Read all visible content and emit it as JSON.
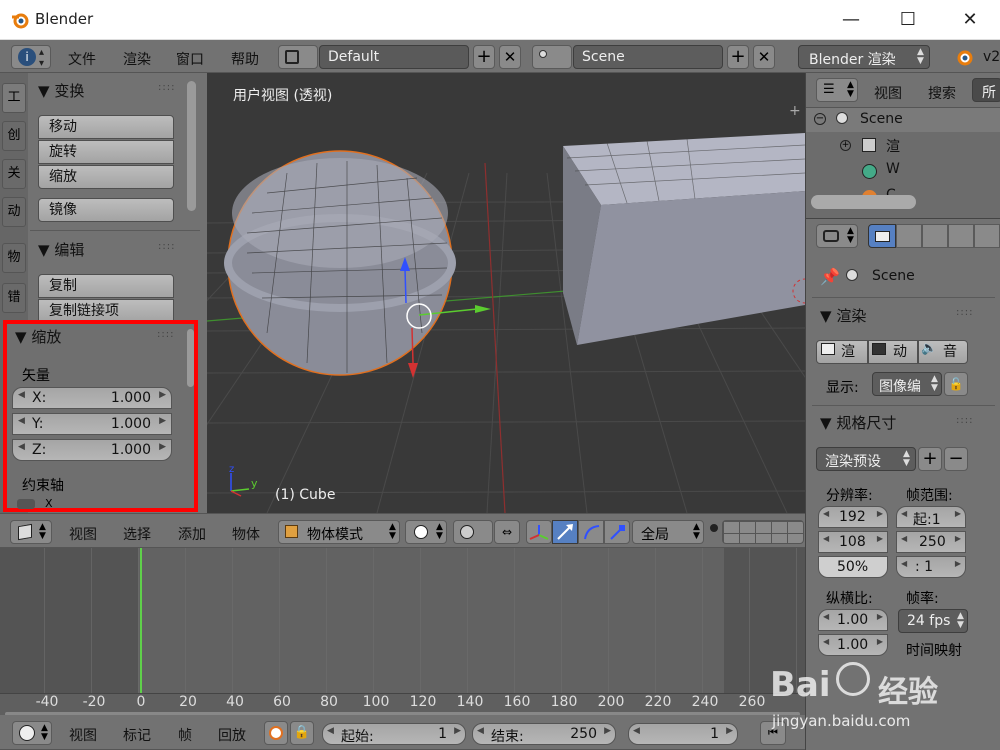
{
  "window": {
    "title": "Blender",
    "minimize": "—",
    "maximize": "☐",
    "close": "✕"
  },
  "topbar": {
    "menu": [
      "文件",
      "渲染",
      "窗口",
      "帮助"
    ],
    "layout": "Default",
    "scene": "Scene",
    "engine": "Blender 渲染",
    "version": "v2"
  },
  "toolshelf": {
    "tabs": [
      "工",
      "创",
      "关",
      "动",
      "物",
      "错"
    ],
    "transform": {
      "title": "变换",
      "buttons": [
        "移动",
        "旋转",
        "缩放"
      ],
      "mirror": "镜像"
    },
    "edit": {
      "title": "编辑",
      "buttons": [
        "复制",
        "复制链接项"
      ]
    }
  },
  "operator": {
    "title": "缩放",
    "vector_label": "矢量",
    "x_label": "X:",
    "x": "1.000",
    "y_label": "Y:",
    "y": "1.000",
    "z_label": "Z:",
    "z": "1.000",
    "constraint_label": "约束轴",
    "cb_x": "X"
  },
  "viewport": {
    "label": "用户视图 (透视)",
    "object": "(1) Cube"
  },
  "view3d_header": {
    "menu": [
      "视图",
      "选择",
      "添加",
      "物体"
    ],
    "mode": "物体模式",
    "orientation": "全局"
  },
  "outliner": {
    "menu": [
      "视图",
      "搜索",
      "所"
    ],
    "items": [
      "Scene",
      "渲",
      "W",
      "C"
    ]
  },
  "properties": {
    "scene_name": "Scene",
    "render_title": "渲染",
    "render_buttons": [
      "渲",
      "动",
      "音"
    ],
    "display_label": "显示:",
    "display_value": "图像编",
    "dimensions_title": "规格尺寸",
    "preset": "渲染预设",
    "res_label": "分辨率:",
    "res_x": "192",
    "res_y": "108",
    "res_pct": "50%",
    "frame_label": "帧范围:",
    "frame_start": "起:1",
    "frame_end": "250",
    "frame_step": ":  1",
    "aspect_label": "纵横比:",
    "aspect_x": "1.00",
    "aspect_y": "1.00",
    "fps_label": "帧率:",
    "fps": "24 fps",
    "remap_label": "时间映射"
  },
  "timeline": {
    "ticks": [
      "-40",
      "-20",
      "0",
      "20",
      "40",
      "60",
      "80",
      "100",
      "120",
      "140",
      "160",
      "180",
      "200",
      "220",
      "240",
      "260"
    ],
    "current_frame": 0
  },
  "bottom": {
    "menu": [
      "视图",
      "标记",
      "帧",
      "回放"
    ],
    "start_label": "起始:",
    "start": "1",
    "end_label": "结束:",
    "end": "250",
    "current": "1"
  },
  "watermark": {
    "text1": "Bai",
    "text2": "经验",
    "url": "jingyan.baidu.com"
  },
  "colors": {
    "highlight": "#ff0000",
    "frame_line": "#5fd04a",
    "x_axis": "#d23232",
    "y_axis": "#5bcc2f",
    "z_axis": "#3050ff"
  }
}
